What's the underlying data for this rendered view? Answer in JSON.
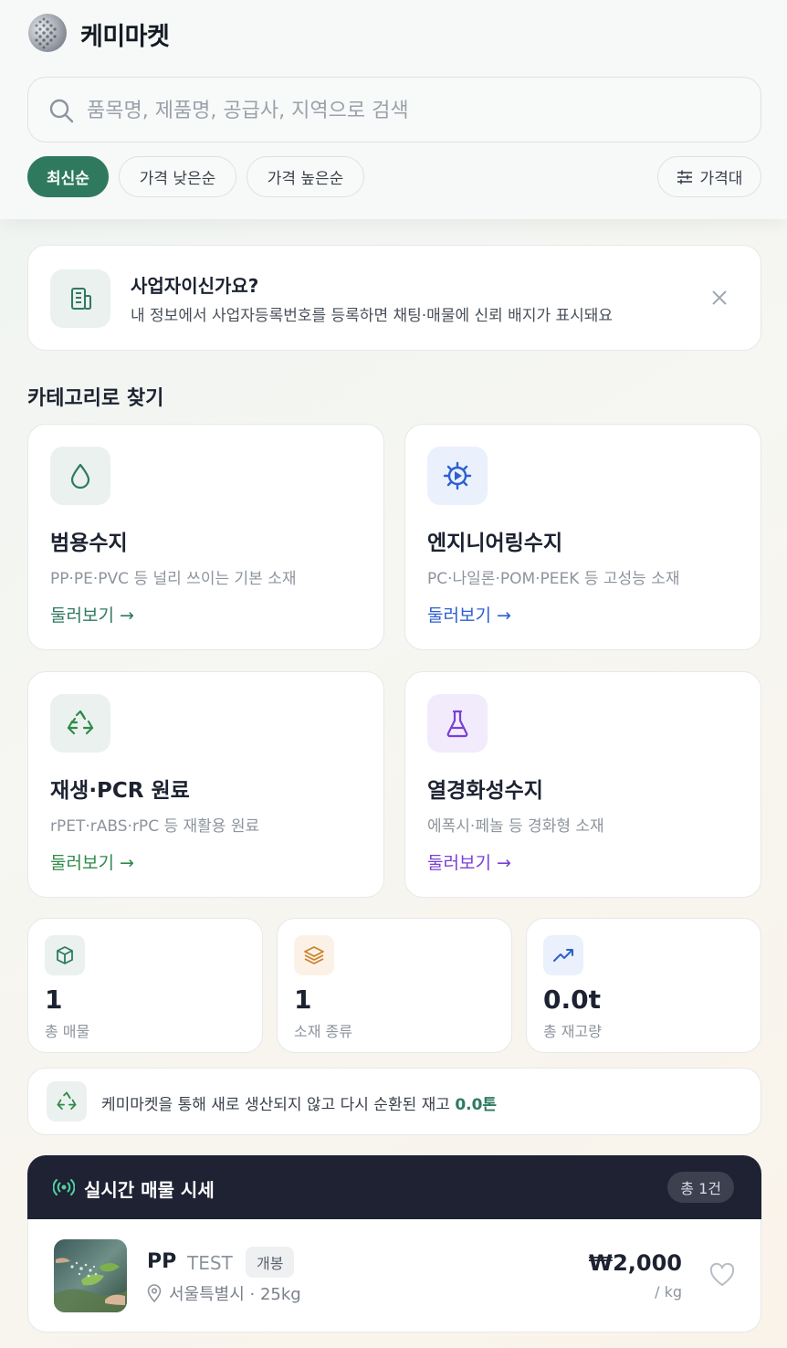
{
  "header": {
    "brand": "케미마켓",
    "search_placeholder": "품목명, 제품명, 공급사, 지역으로 검색",
    "sort_chips": [
      "최신순",
      "가격 낮은순",
      "가격 높은순"
    ],
    "active_sort": "최신순",
    "price_filter_label": "가격대"
  },
  "banner": {
    "title": "사업자이신가요?",
    "subtitle": "내 정보에서 사업자등록번호를 등록하면 채팅·매물에 신뢰 배지가 표시돼요"
  },
  "categories": {
    "title": "카테고리로 찾기",
    "items": [
      {
        "name": "범용수지",
        "desc": "PP·PE·PVC 등 널리 쓰이는 기본 소재",
        "more": "둘러보기 →",
        "icon": "droplet-icon",
        "color": "#2f7a5f",
        "bg": "#eaf1ee"
      },
      {
        "name": "엔지니어링수지",
        "desc": "PC·나일론·POM·PEEK 등 고성능 소재",
        "more": "둘러보기 →",
        "icon": "gear-icon",
        "color": "#2d5fd1",
        "bg": "#eaf0fc"
      },
      {
        "name": "재생·PCR 원료",
        "desc": "rPET·rABS·rPC 등 재활용 원료",
        "more": "둘러보기 →",
        "icon": "recycle-icon",
        "color": "#2f8a4a",
        "bg": "#eaf1ee"
      },
      {
        "name": "열경화성수지",
        "desc": "에폭시·페놀 등 경화형 소재",
        "more": "둘러보기 →",
        "icon": "flask-icon",
        "color": "#7a3fd6",
        "bg": "#f1ebfb"
      }
    ]
  },
  "stats": [
    {
      "value": "1",
      "label": "총 매물",
      "icon": "box-icon",
      "color": "#2f7a5f",
      "bg": "#eaf1ee"
    },
    {
      "value": "1",
      "label": "소재 종류",
      "icon": "layers-icon",
      "color": "#c9822a",
      "bg": "#fcf1e6"
    },
    {
      "value": "0.0t",
      "label": "총 재고량",
      "icon": "trend-up-icon",
      "color": "#2d5fd1",
      "bg": "#eaf0fc"
    }
  ],
  "eco": {
    "text": "케미마켓을 통해 새로 생산되지 않고 다시 순환된 재고",
    "highlight": "0.0톤"
  },
  "live": {
    "title": "실시간 매물 시세",
    "count_badge": "총 1건",
    "listings": [
      {
        "material": "PP",
        "product": "TEST",
        "tag": "개봉",
        "location": "서울특별시 · 25kg",
        "price": "₩2,000",
        "unit": "/ kg"
      }
    ]
  }
}
